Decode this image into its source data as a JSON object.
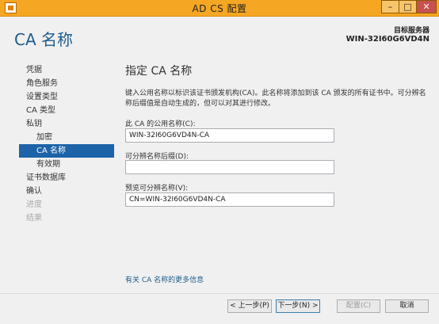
{
  "window": {
    "title": "AD CS 配置",
    "minimize_glyph": "–",
    "maximize_glyph": "□",
    "close_glyph": "✕"
  },
  "header": {
    "page_title": "CA 名称",
    "target_label": "目标服务器",
    "target_server": "WIN-32I60G6VD4N"
  },
  "nav": {
    "items": [
      {
        "label": "凭据"
      },
      {
        "label": "角色服务"
      },
      {
        "label": "设置类型"
      },
      {
        "label": "CA 类型"
      },
      {
        "label": "私钥"
      },
      {
        "label": "加密"
      },
      {
        "label": "CA 名称"
      },
      {
        "label": "有效期"
      },
      {
        "label": "证书数据库"
      },
      {
        "label": "确认"
      },
      {
        "label": "进度"
      },
      {
        "label": "结果"
      }
    ]
  },
  "main": {
    "section_title": "指定 CA 名称",
    "description": "键入公用名称以标识该证书颁发机构(CA)。此名称将添加到该 CA 颁发的所有证书中。可分辨名称后缀值是自动生成的，但可以对其进行修改。",
    "common_name_label": "此 CA 的公用名称(C):",
    "common_name_value": "WIN-32I60G6VD4N-CA",
    "dn_suffix_label": "可分辨名称后缀(D):",
    "dn_suffix_value": "",
    "preview_label": "预览可分辨名称(V):",
    "preview_value": "CN=WIN-32I60G6VD4N-CA",
    "more_info_link": "有关 CA 名称的更多信息"
  },
  "footer": {
    "prev_label": "< 上一步(P)",
    "next_label": "下一步(N) >",
    "configure_label": "配置(C)",
    "cancel_label": "取消"
  }
}
